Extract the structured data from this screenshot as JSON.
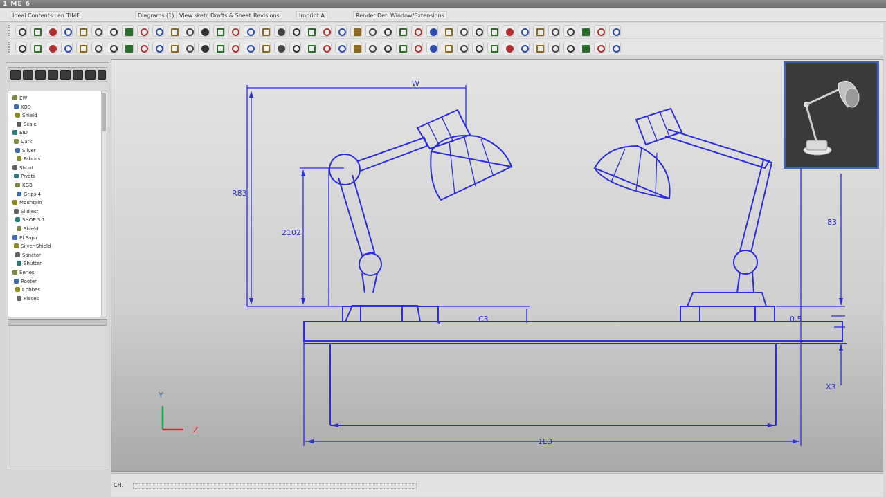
{
  "app": {
    "title": "1 ME 6"
  },
  "menu": [
    "Ideal Contents Lamps",
    "TIME",
    "Diagrams (1)",
    "View sketch",
    "Drafts & Sheets",
    "Revisions",
    "Imprint A",
    "Render Details",
    "Window/Extensions"
  ],
  "toolbar_top_icons": [
    "pan",
    "rotate",
    "zoom",
    "zoom-fit",
    "select",
    "snap",
    "grid",
    "measure",
    "trim",
    "extend",
    "mirror",
    "offset",
    "array",
    "fillet",
    "chamfer",
    "layer",
    "color",
    "render",
    "shade",
    "wire",
    "section",
    "hide",
    "show",
    "dimension",
    "note",
    "print",
    "export",
    "save",
    "open",
    "undo",
    "redo",
    "help",
    "settings",
    "view",
    "light",
    "material",
    "camera",
    "capture",
    "hatch",
    "block"
  ],
  "toolbar_bottom_icons": [
    "line",
    "arc",
    "circle",
    "rectangle",
    "polygon",
    "spline",
    "point",
    "text",
    "sketch",
    "constraint",
    "pattern",
    "extrude",
    "revolve",
    "sweep",
    "loft",
    "shell",
    "hole",
    "rib",
    "draft",
    "split",
    "combine",
    "move",
    "copy",
    "scale",
    "align",
    "group",
    "ungroup",
    "lock",
    "unlock",
    "hidden",
    "orbit",
    "walk",
    "frame",
    "top",
    "front",
    "side",
    "iso",
    "perspective",
    "ortho",
    "fit"
  ],
  "tree": {
    "items": [
      "EW",
      "KOS",
      "Shield",
      "Scale",
      "EID",
      "Dark",
      "Silver",
      "Fabrics",
      "Shoot",
      "Pivots",
      "KGB",
      "Grips 4",
      "Mountain",
      "Slidiest",
      "SHOE 3 1",
      "Shield",
      "El Saplr",
      "Silver Shield",
      "Sanctor",
      "Shutter",
      "Series",
      "Rooter",
      "Cobbes",
      "Places"
    ]
  },
  "drawing": {
    "dims": {
      "width_top": "W",
      "height_outer": "R83",
      "height_inner": "2102",
      "desk_mid": "C3",
      "right_upper": "83",
      "right_mid": "0.5",
      "right_lower": "X3",
      "desk_width": "1E3"
    },
    "axes": {
      "y": "Y",
      "x": "Z"
    }
  },
  "status": {
    "left": "CH.",
    "right": ""
  }
}
